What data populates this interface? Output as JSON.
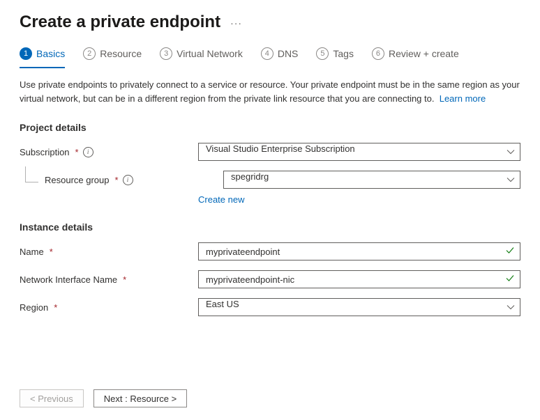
{
  "title": "Create a private endpoint",
  "tabs": [
    {
      "num": "1",
      "label": "Basics"
    },
    {
      "num": "2",
      "label": "Resource"
    },
    {
      "num": "3",
      "label": "Virtual Network"
    },
    {
      "num": "4",
      "label": "DNS"
    },
    {
      "num": "5",
      "label": "Tags"
    },
    {
      "num": "6",
      "label": "Review + create"
    }
  ],
  "description": "Use private endpoints to privately connect to a service or resource. Your private endpoint must be in the same region as your virtual network, but can be in a different region from the private link resource that you are connecting to.",
  "learn_more": "Learn more",
  "sections": {
    "project": {
      "heading": "Project details",
      "subscription_label": "Subscription",
      "subscription_value": "Visual Studio Enterprise Subscription",
      "resource_group_label": "Resource group",
      "resource_group_value": "spegridrg",
      "create_new": "Create new"
    },
    "instance": {
      "heading": "Instance details",
      "name_label": "Name",
      "name_value": "myprivateendpoint",
      "nic_label": "Network Interface Name",
      "nic_value": "myprivateendpoint-nic",
      "region_label": "Region",
      "region_value": "East US"
    }
  },
  "footer": {
    "previous": "< Previous",
    "next": "Next : Resource >"
  }
}
